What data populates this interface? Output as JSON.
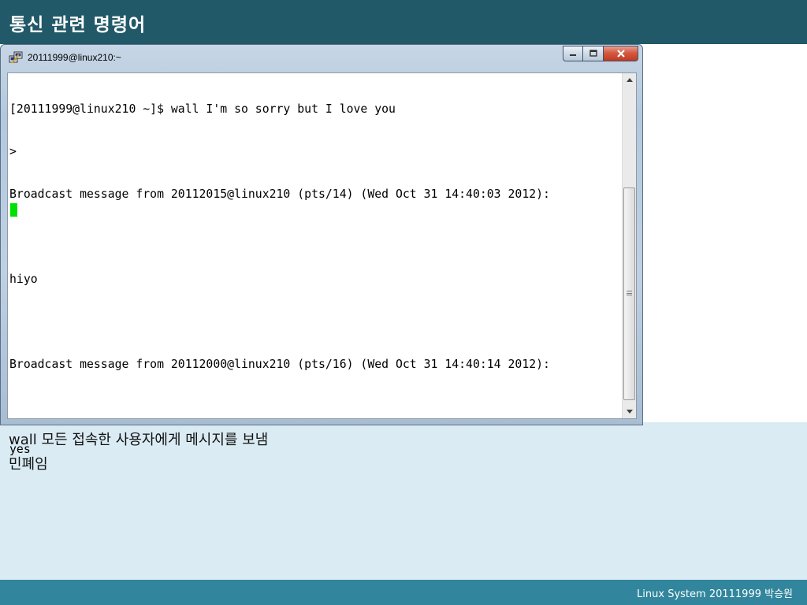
{
  "slide": {
    "title": "통신 관련 명령어",
    "body_lines": [
      "wall 모든 접속한 사용자에게 메시지를 보냄",
      "민폐임"
    ],
    "footer": "Linux System 20111999 박승원"
  },
  "window": {
    "title": "20111999@linux210:~",
    "icon": "putty-icon",
    "buttons": [
      "minimize",
      "maximize",
      "close"
    ]
  },
  "terminal": {
    "lines": [
      "[20111999@linux210 ~]$ wall I'm so sorry but I love you",
      ">",
      "Broadcast message from 20112015@linux210 (pts/14) (Wed Oct 31 14:40:03 2012):",
      "",
      "hiyo",
      "",
      "Broadcast message from 20112000@linux210 (pts/16) (Wed Oct 31 14:40:14 2012):",
      "",
      "yes"
    ],
    "cursor_color": "#00e000"
  },
  "colors": {
    "title_bar": "#215968",
    "content_bg": "#daebf3",
    "footer_bar": "#31859c"
  }
}
